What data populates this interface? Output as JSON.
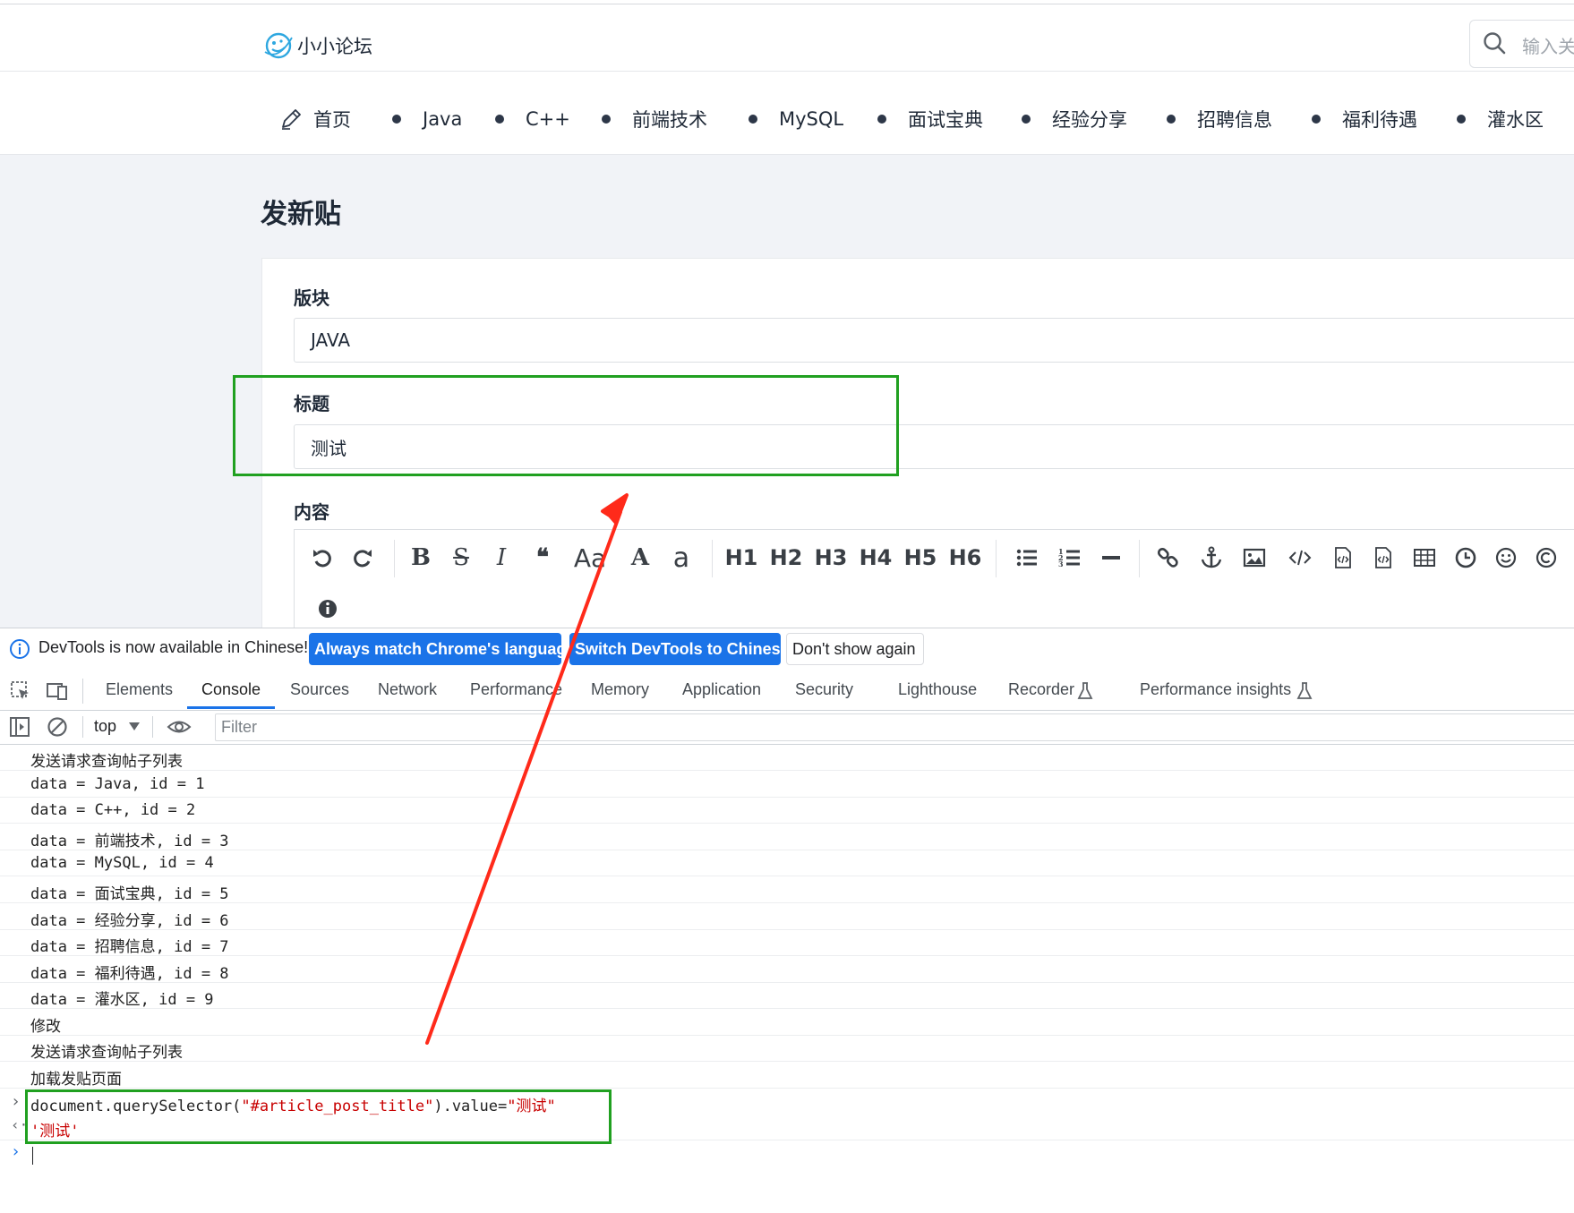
{
  "header": {
    "brand": "小小论坛",
    "search_placeholder": "输入关"
  },
  "nav": {
    "items": [
      {
        "label": "首页"
      },
      {
        "label": "Java"
      },
      {
        "label": "C++"
      },
      {
        "label": "前端技术"
      },
      {
        "label": "MySQL"
      },
      {
        "label": "面试宝典"
      },
      {
        "label": "经验分享"
      },
      {
        "label": "招聘信息"
      },
      {
        "label": "福利待遇"
      },
      {
        "label": "灌水区"
      }
    ]
  },
  "page": {
    "title": "发新贴",
    "board_label": "版块",
    "board_value": "JAVA",
    "title_label": "标题",
    "title_value": "测试",
    "content_label": "内容"
  },
  "editor_toolbar": {
    "headings": [
      "H1",
      "H2",
      "H3",
      "H4",
      "H5",
      "H6"
    ],
    "icons": [
      "undo-icon",
      "redo-icon",
      "bold-icon",
      "strikethrough-icon",
      "italic-icon",
      "quote-icon",
      "uppercase-icon",
      "font-size-icon",
      "lowercase-icon",
      "unordered-list-icon",
      "ordered-list-icon",
      "horizontal-rule-icon",
      "link-icon",
      "anchor-icon",
      "image-icon",
      "code-icon",
      "code-block-icon",
      "preformatted-icon",
      "table-icon",
      "datetime-icon",
      "emoji-icon",
      "copyright-icon",
      "info-icon"
    ],
    "glyphs": {
      "bold": "B",
      "strike": "S",
      "italic": "I",
      "quote": "❝",
      "upper": "Aa",
      "font": "A",
      "lower": "a"
    }
  },
  "devtools": {
    "banner": {
      "text": "DevTools is now available in Chinese!",
      "btn_match": "Always match Chrome's language",
      "btn_switch": "Switch DevTools to Chinese",
      "btn_dismiss": "Don't show again"
    },
    "tabs": [
      "Elements",
      "Console",
      "Sources",
      "Network",
      "Performance",
      "Memory",
      "Application",
      "Security",
      "Lighthouse",
      "Recorder",
      "Performance insights"
    ],
    "active_tab": "Console",
    "context": "top",
    "filter_placeholder": "Filter",
    "console_lines": [
      "发送请求查询帖子列表",
      "data = Java, id = 1",
      "data = C++, id = 2",
      "data = 前端技术, id = 3",
      "data = MySQL, id = 4",
      "data = 面试宝典, id = 5",
      "data = 经验分享, id = 6",
      "data = 招聘信息, id = 7",
      "data = 福利待遇, id = 8",
      "data = 灌水区, id = 9",
      "修改",
      "发送请求查询帖子列表",
      "加载发贴页面"
    ],
    "command": {
      "prefix": "document.querySelector(",
      "selector": "\"#article_post_title\"",
      "middle": ").value=",
      "value": "\"测试\"",
      "result": "'测试'"
    }
  },
  "colors": {
    "highlight": "#20a020",
    "arrow": "#ff2a1a",
    "devtools_blue": "#1a73e8",
    "string_red": "#c80000"
  }
}
